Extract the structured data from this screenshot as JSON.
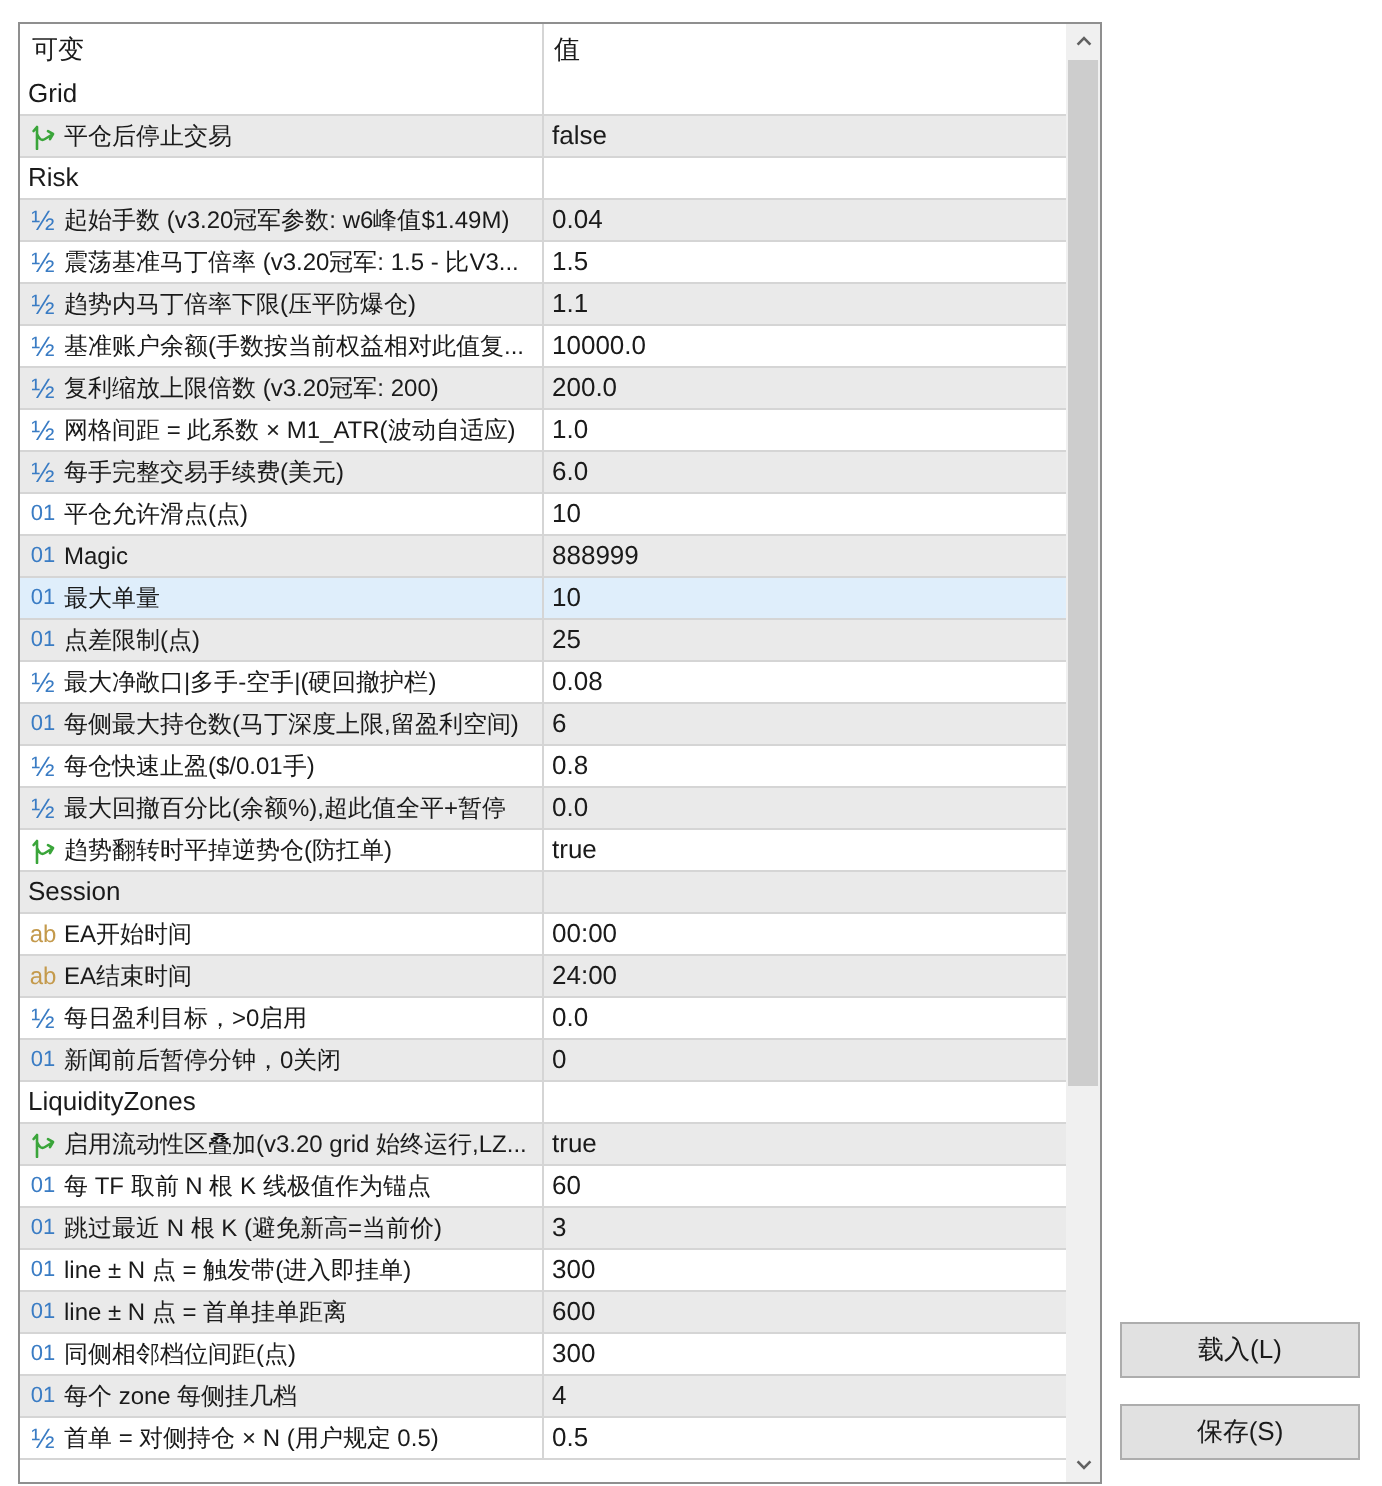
{
  "table": {
    "columns": [
      "可变",
      "值"
    ],
    "rows": [
      {
        "kind": "group",
        "name": "Grid",
        "selected": false
      },
      {
        "kind": "bool",
        "name": "平仓后停止交易",
        "value": "false",
        "selected": false
      },
      {
        "kind": "group",
        "name": "Risk",
        "selected": false
      },
      {
        "kind": "double",
        "icon": "½",
        "name": "起始手数 (v3.20冠军参数: w6峰值$1.49M)",
        "value": "0.04",
        "selected": false
      },
      {
        "kind": "double",
        "icon": "½",
        "name": "震荡基准马丁倍率 (v3.20冠军: 1.5 - 比V3...",
        "value": "1.5",
        "selected": false
      },
      {
        "kind": "double",
        "icon": "½",
        "name": "趋势内马丁倍率下限(压平防爆仓)",
        "value": "1.1",
        "selected": false
      },
      {
        "kind": "double",
        "icon": "½",
        "name": "基准账户余额(手数按当前权益相对此值复...",
        "value": "10000.0",
        "selected": false
      },
      {
        "kind": "double",
        "icon": "½",
        "name": "复利缩放上限倍数 (v3.20冠军: 200)",
        "value": "200.0",
        "selected": false
      },
      {
        "kind": "double",
        "icon": "½",
        "name": "网格间距 = 此系数 × M1_ATR(波动自适应)",
        "value": "1.0",
        "selected": false
      },
      {
        "kind": "double",
        "icon": "½",
        "name": "每手完整交易手续费(美元)",
        "value": "6.0",
        "selected": false
      },
      {
        "kind": "int",
        "icon": "01",
        "name": "平仓允许滑点(点)",
        "value": "10",
        "selected": false
      },
      {
        "kind": "int",
        "icon": "01",
        "name": "Magic",
        "value": "888999",
        "selected": false
      },
      {
        "kind": "int",
        "icon": "01",
        "name": "最大单量",
        "value": "10",
        "selected": true
      },
      {
        "kind": "int",
        "icon": "01",
        "name": "点差限制(点)",
        "value": "25",
        "selected": false
      },
      {
        "kind": "double",
        "icon": "½",
        "name": "最大净敞口|多手-空手|(硬回撤护栏)",
        "value": "0.08",
        "selected": false
      },
      {
        "kind": "int",
        "icon": "01",
        "name": "每侧最大持仓数(马丁深度上限,留盈利空间)",
        "value": "6",
        "selected": false
      },
      {
        "kind": "double",
        "icon": "½",
        "name": "每仓快速止盈($/0.01手)",
        "value": "0.8",
        "selected": false
      },
      {
        "kind": "double",
        "icon": "½",
        "name": "最大回撤百分比(余额%),超此值全平+暂停",
        "value": "0.0",
        "selected": false
      },
      {
        "kind": "bool",
        "name": "趋势翻转时平掉逆势仓(防扛单)",
        "value": "true",
        "selected": false
      },
      {
        "kind": "group",
        "name": "Session",
        "selected": false
      },
      {
        "kind": "string",
        "icon": "ab",
        "name": "EA开始时间",
        "value": "00:00",
        "selected": false
      },
      {
        "kind": "string",
        "icon": "ab",
        "name": "EA结束时间",
        "value": "24:00",
        "selected": false
      },
      {
        "kind": "double",
        "icon": "½",
        "name": "每日盈利目标，>0启用",
        "value": "0.0",
        "selected": false
      },
      {
        "kind": "int",
        "icon": "01",
        "name": "新闻前后暂停分钟，0关闭",
        "value": "0",
        "selected": false
      },
      {
        "kind": "group",
        "name": "LiquidityZones",
        "selected": false
      },
      {
        "kind": "bool",
        "name": "启用流动性区叠加(v3.20 grid 始终运行,LZ...",
        "value": "true",
        "selected": false
      },
      {
        "kind": "int",
        "icon": "01",
        "name": "每 TF 取前 N 根 K 线极值作为锚点",
        "value": "60",
        "selected": false
      },
      {
        "kind": "int",
        "icon": "01",
        "name": "跳过最近 N 根 K (避免新高=当前价)",
        "value": "3",
        "selected": false
      },
      {
        "kind": "int",
        "icon": "01",
        "name": "line ± N 点 = 触发带(进入即挂单)",
        "value": "300",
        "selected": false
      },
      {
        "kind": "int",
        "icon": "01",
        "name": "line ± N 点 = 首单挂单距离",
        "value": "600",
        "selected": false
      },
      {
        "kind": "int",
        "icon": "01",
        "name": "同侧相邻档位间距(点)",
        "value": "300",
        "selected": false
      },
      {
        "kind": "int",
        "icon": "01",
        "name": "每个 zone 每侧挂几档",
        "value": "4",
        "selected": false
      },
      {
        "kind": "double",
        "icon": "½",
        "name": "首单 = 对侧持仓 × N (用户规定 0.5)",
        "value": "0.5",
        "selected": false
      }
    ]
  },
  "buttons": [
    "载入(L)",
    "保存(S)"
  ]
}
